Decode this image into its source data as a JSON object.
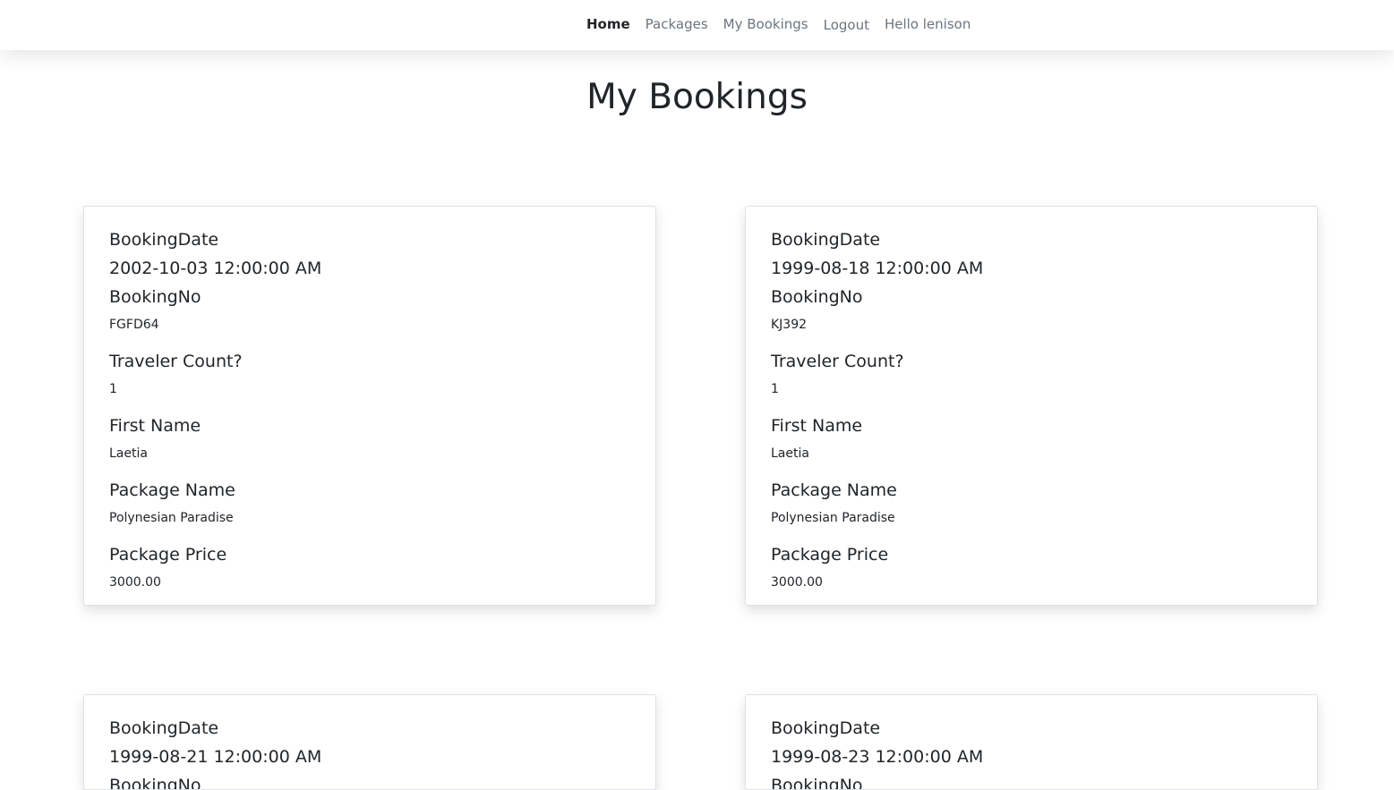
{
  "nav": {
    "home": "Home",
    "packages": "Packages",
    "my_bookings": "My Bookings",
    "logout": "Logout",
    "greeting": "Hello lenison"
  },
  "page": {
    "title": "My Bookings"
  },
  "labels": {
    "booking_date": "BookingDate",
    "booking_no": "BookingNo",
    "traveler_count": "Traveler Count?",
    "first_name": "First Name",
    "package_name": "Package Name",
    "package_price": "Package Price"
  },
  "bookings": [
    {
      "booking_date": "2002-10-03 12:00:00 AM",
      "booking_no": "FGFD64",
      "traveler_count": "1",
      "first_name": "Laetia",
      "package_name": "Polynesian Paradise",
      "package_price": "3000.00"
    },
    {
      "booking_date": "1999-08-18 12:00:00 AM",
      "booking_no": "KJ392",
      "traveler_count": "1",
      "first_name": "Laetia",
      "package_name": "Polynesian Paradise",
      "package_price": "3000.00"
    },
    {
      "booking_date": "1999-08-21 12:00:00 AM"
    },
    {
      "booking_date": "1999-08-23 12:00:00 AM"
    }
  ]
}
